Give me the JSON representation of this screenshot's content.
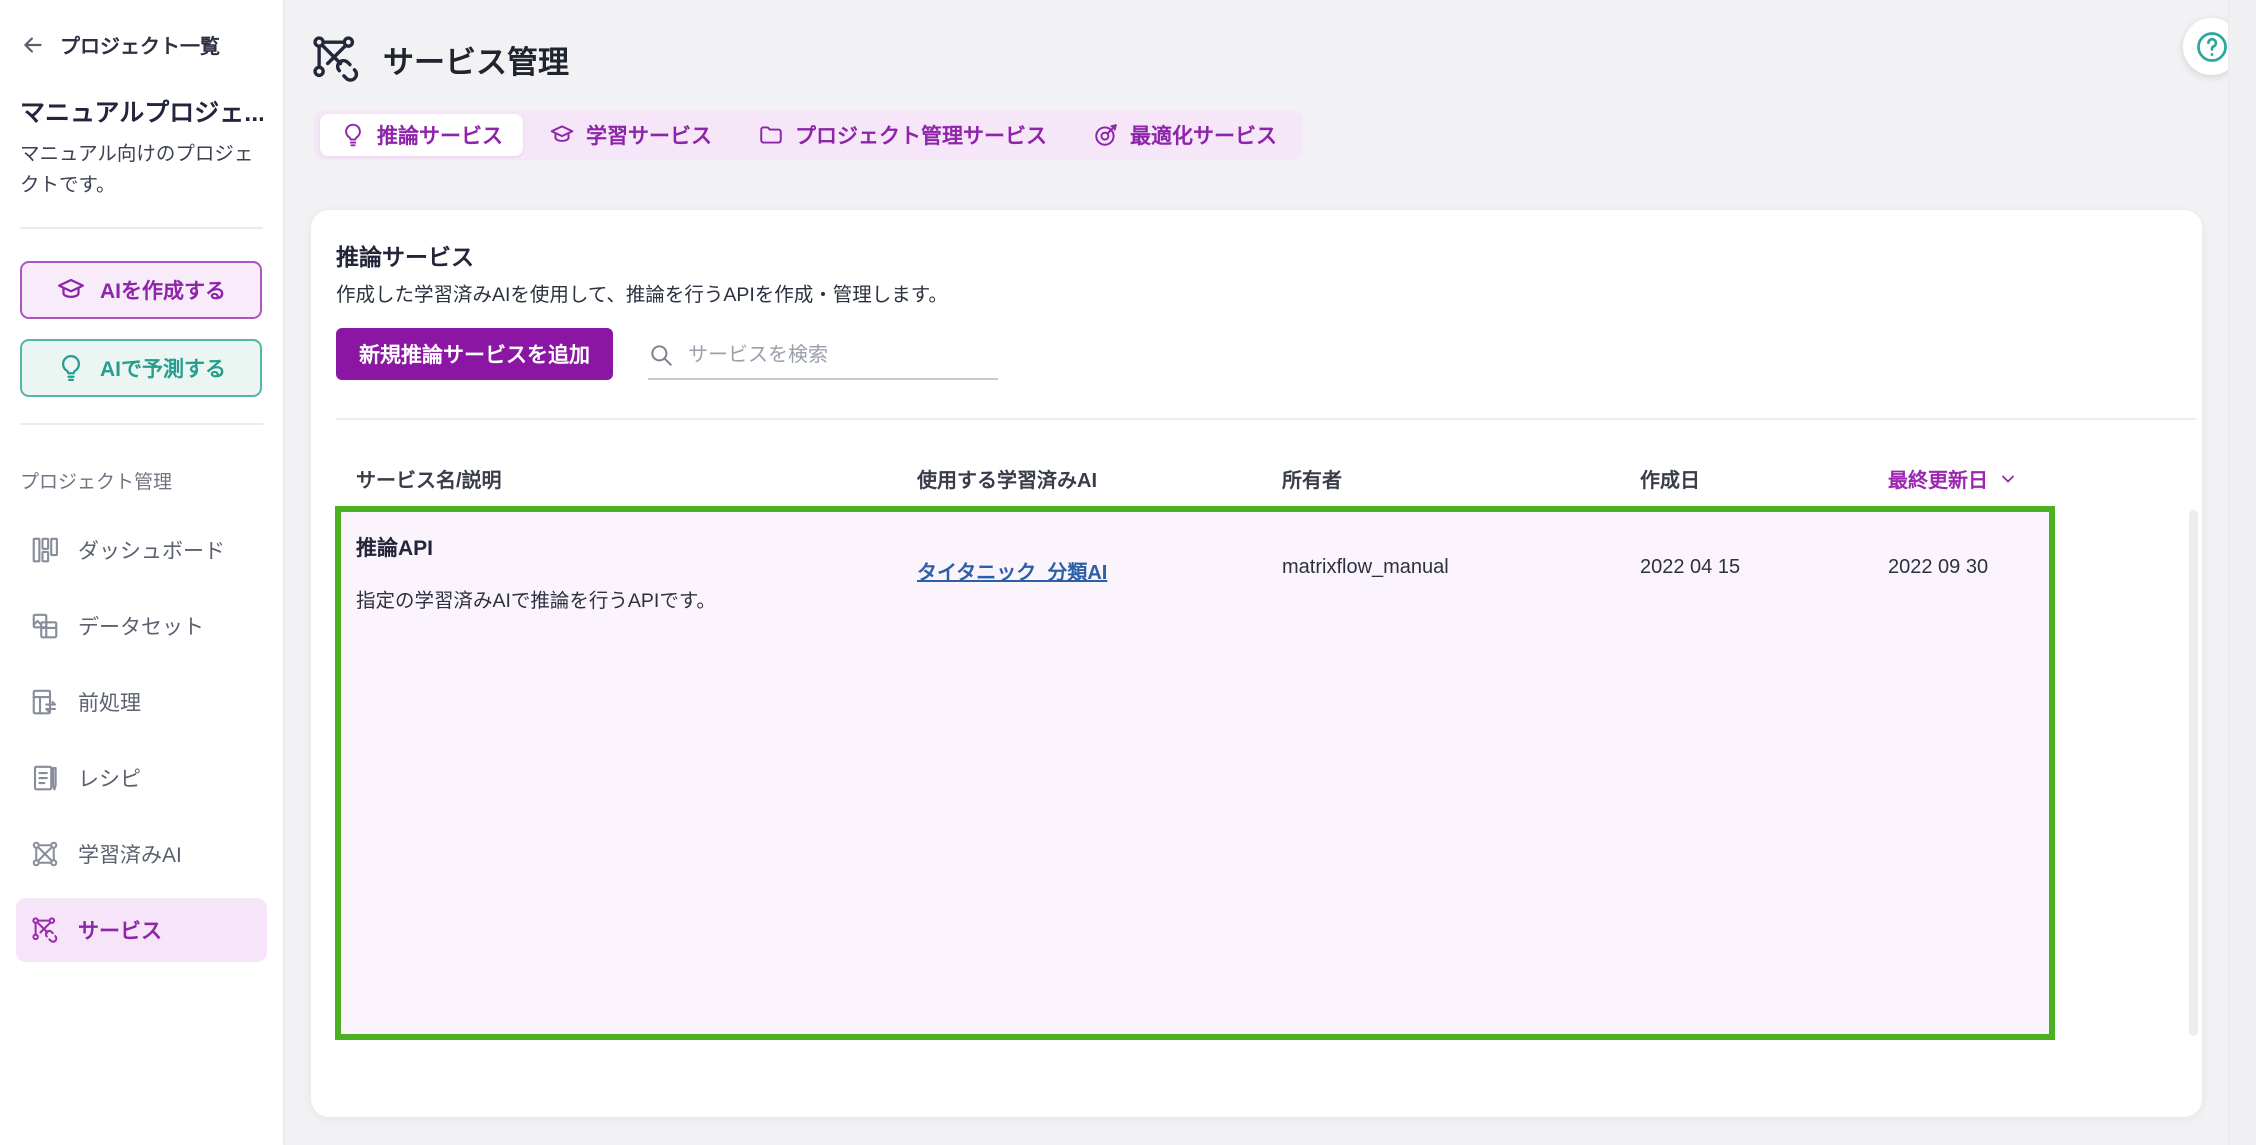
{
  "sidebar": {
    "back_label": "プロジェクト一覧",
    "project_title": "マニュアルプロジェ...",
    "project_description": "マニュアル向けのプロジェクトです。",
    "create_ai_button": "AIを作成する",
    "predict_ai_button": "AIで予測する",
    "section_label": "プロジェクト管理",
    "items": [
      {
        "label": "ダッシュボード",
        "icon": "dashboard-icon"
      },
      {
        "label": "データセット",
        "icon": "dataset-icon"
      },
      {
        "label": "前処理",
        "icon": "preprocess-icon"
      },
      {
        "label": "レシピ",
        "icon": "recipe-icon"
      },
      {
        "label": "学習済みAI",
        "icon": "trained-ai-icon"
      },
      {
        "label": "サービス",
        "icon": "service-icon",
        "active": true
      }
    ]
  },
  "header": {
    "title": "サービス管理",
    "title_icon": "service-network-link-icon",
    "help_icon": "question-circle-icon"
  },
  "tabs": [
    {
      "label": "推論サービス",
      "icon": "lightbulb-icon",
      "active": true
    },
    {
      "label": "学習サービス",
      "icon": "graduation-cap-icon",
      "active": false
    },
    {
      "label": "プロジェクト管理サービス",
      "icon": "folder-icon",
      "active": false
    },
    {
      "label": "最適化サービス",
      "icon": "optimize-target-icon",
      "active": false
    }
  ],
  "panel": {
    "title": "推論サービス",
    "description": "作成した学習済みAIを使用して、推論を行うAPIを作成・管理します。",
    "add_button": "新規推論サービスを追加",
    "search_placeholder": "サービスを検索"
  },
  "table": {
    "columns": [
      "サービス名/説明",
      "使用する学習済みAI",
      "所有者",
      "作成日",
      "最終更新日"
    ],
    "sort_column": "最終更新日",
    "rows": [
      {
        "name": "推論API",
        "description": "指定の学習済みAIで推論を行うAPIです。",
        "trained_ai": "タイタニック_分類AI",
        "owner": "matrixflow_manual",
        "created": "2022 04 15",
        "updated": "2022 09 30"
      }
    ]
  },
  "colors": {
    "accent_purple": "#8e24aa",
    "button_purple": "#8a16a3",
    "teal": "#279d8e",
    "highlight_green_border": "#4cb122",
    "row_background": "#fbf4fc",
    "link_blue": "#2b5fa7",
    "tab_bar_background": "#f6e7f8"
  }
}
